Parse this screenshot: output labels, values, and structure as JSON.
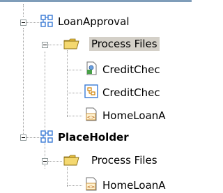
{
  "tree": {
    "nodes": [
      {
        "label": "LoanApproval"
      },
      {
        "label": "Process Files"
      },
      {
        "label": "CreditChec"
      },
      {
        "label": "CreditChec"
      },
      {
        "label": "HomeLoanA"
      },
      {
        "label": "PlaceHolder"
      },
      {
        "label": "Process Files"
      },
      {
        "label": "HomeLoanA"
      }
    ]
  },
  "colors": {
    "selection": "#d4d0c8",
    "folder": "#f0d060",
    "project": "#3a7bd5"
  },
  "icons": [
    "project-icon",
    "folder-icon",
    "wsdl-file-icon",
    "bpel-file-icon",
    "xsd-file-icon"
  ]
}
